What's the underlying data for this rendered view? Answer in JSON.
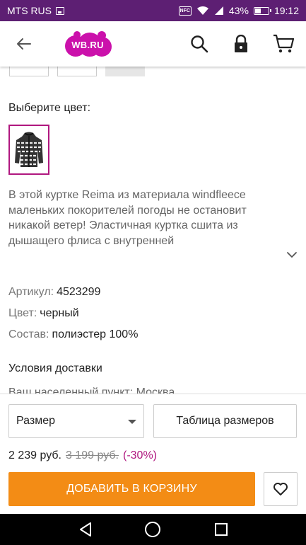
{
  "status_bar": {
    "carrier": "MTS RUS",
    "nfc": "NFC",
    "battery": "43%",
    "time": "19:12"
  },
  "header": {
    "logo_text": "WB.RU",
    "brand_color": "#cb11ab",
    "icons": [
      "back-arrow-icon",
      "search-icon",
      "lock-icon",
      "cart-icon"
    ]
  },
  "product": {
    "color_label": "Выберите цвет:",
    "description": "В этой куртке Reima из материала windfleece маленьких покорителей погоды не остановит никакой ветер! Эластичная куртка сшита из дышащего флиса с внутренней",
    "specs": {
      "article_label": "Артикул:",
      "article_value": "4523299",
      "color_label": "Цвет:",
      "color_value": "черный",
      "composition_label": "Состав:",
      "composition_value": "полиэстер 100%"
    },
    "delivery_title": "Условия доставки",
    "delivery_partial": "Ваш населенный пункт: Москва"
  },
  "bottom": {
    "size_select": {
      "value": "Размер"
    },
    "size_table_label": "Таблица размеров",
    "price_current": "2 239 руб.",
    "price_old": "3 199 руб.",
    "discount": "(-30%)",
    "add_to_cart_label": "ДОБАВИТЬ В КОРЗИНУ",
    "accent_color": "#f38c15",
    "discount_color": "#b0177f"
  },
  "nav_bar": {
    "icons": [
      "back-triangle-icon",
      "home-circle-icon",
      "recents-square-icon"
    ]
  }
}
